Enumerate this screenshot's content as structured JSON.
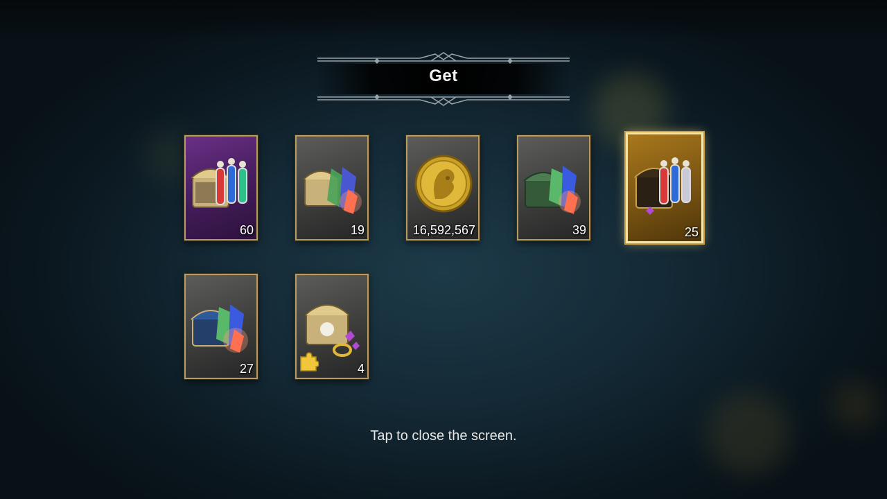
{
  "dialog": {
    "title": "Get",
    "close_hint": "Tap to close the screen."
  },
  "colors": {
    "frame_gold": "#b89b5e",
    "selected_frame": "#f4e4a8",
    "purple_bg": "#6a2f86",
    "grey_bg": "#5c5c5a",
    "gold_bg": "#a9781d"
  },
  "rewards": [
    {
      "icon": "potion-chest-icon",
      "quantity": "60",
      "rarity_bg": "purple",
      "selected": false
    },
    {
      "icon": "crystal-chest-icon",
      "quantity": "19",
      "rarity_bg": "grey",
      "selected": false
    },
    {
      "icon": "gold-coin-icon",
      "quantity": "16,592,567",
      "rarity_bg": "grey",
      "selected": false
    },
    {
      "icon": "rainbow-crystal-chest-icon",
      "quantity": "39",
      "rarity_bg": "grey",
      "selected": false
    },
    {
      "icon": "ornate-potion-chest-icon",
      "quantity": "25",
      "rarity_bg": "gold",
      "selected": true
    },
    {
      "icon": "blue-crystal-chest-icon",
      "quantity": "27",
      "rarity_bg": "grey",
      "selected": false
    },
    {
      "icon": "jewelry-chest-icon",
      "quantity": "4",
      "rarity_bg": "grey",
      "selected": false,
      "badge": "puzzle-piece-icon"
    }
  ]
}
